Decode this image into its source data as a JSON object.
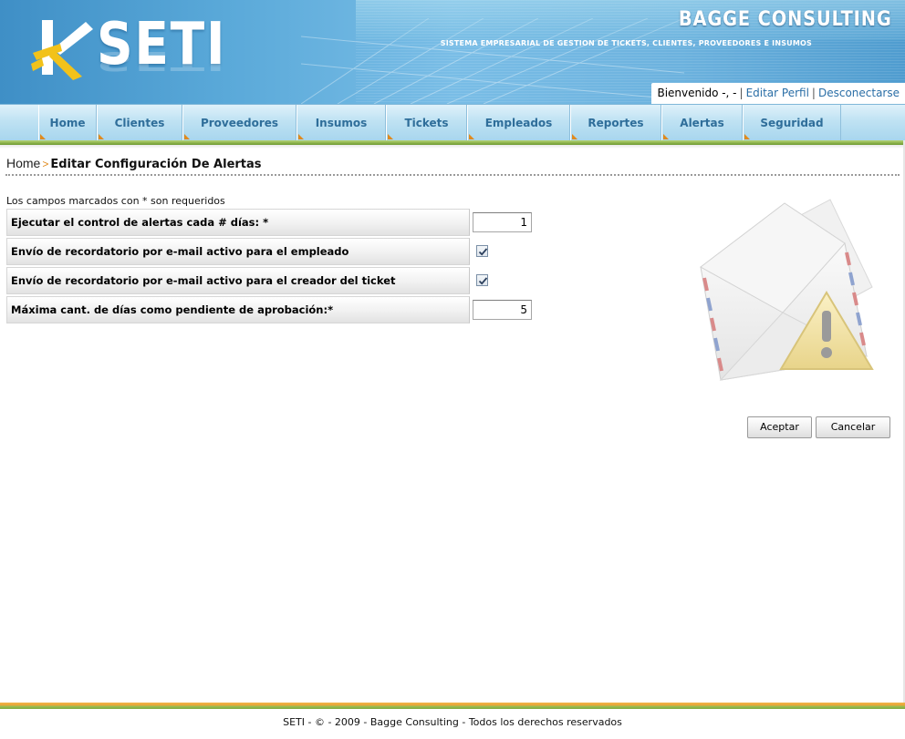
{
  "header": {
    "logo_text": "SETI",
    "company_name": "BAGGE CONSULTING",
    "tagline": "SISTEMA EMPRESARIAL DE GESTION DE TICKETS, CLIENTES, PROVEEDORES E INSUMOS",
    "welcome_text": "Bienvenido -, -",
    "edit_profile": "Editar Perfil",
    "logout": "Desconectarse"
  },
  "nav": {
    "items": [
      {
        "label": "Home"
      },
      {
        "label": "Clientes"
      },
      {
        "label": "Proveedores"
      },
      {
        "label": "Insumos"
      },
      {
        "label": "Tickets"
      },
      {
        "label": "Empleados"
      },
      {
        "label": "Reportes"
      },
      {
        "label": "Alertas"
      },
      {
        "label": "Seguridad"
      }
    ]
  },
  "breadcrumb": {
    "home": "Home",
    "current": "Editar Configuración De Alertas"
  },
  "form": {
    "required_note": "Los campos marcados con * son requeridos",
    "fields": [
      {
        "label": "Ejecutar el control de alertas cada # días: *",
        "type": "number",
        "value": "1"
      },
      {
        "label": "Envío de recordatorio por e-mail activo para el empleado",
        "type": "checkbox",
        "checked": true
      },
      {
        "label": "Envío de recordatorio por e-mail activo para el creador del ticket",
        "type": "checkbox",
        "checked": true
      },
      {
        "label": "Máxima cant. de días como pendiente de aprobación:*",
        "type": "number",
        "value": "5"
      }
    ]
  },
  "buttons": {
    "accept": "Aceptar",
    "cancel": "Cancelar"
  },
  "footer": {
    "text": "SETI - © - 2009 - Bagge Consulting - Todos los derechos reservados"
  },
  "colors": {
    "brand_blue": "#3f8fc6",
    "nav_text": "#2f6e9a",
    "accent_orange": "#e08a1e",
    "accent_green": "#8ab14a",
    "link": "#2a6ea6"
  },
  "icons": {
    "logo": "seti-logo-mark-icon",
    "illustration": "envelope-warning-icon",
    "checkbox": "checkmark-icon"
  }
}
